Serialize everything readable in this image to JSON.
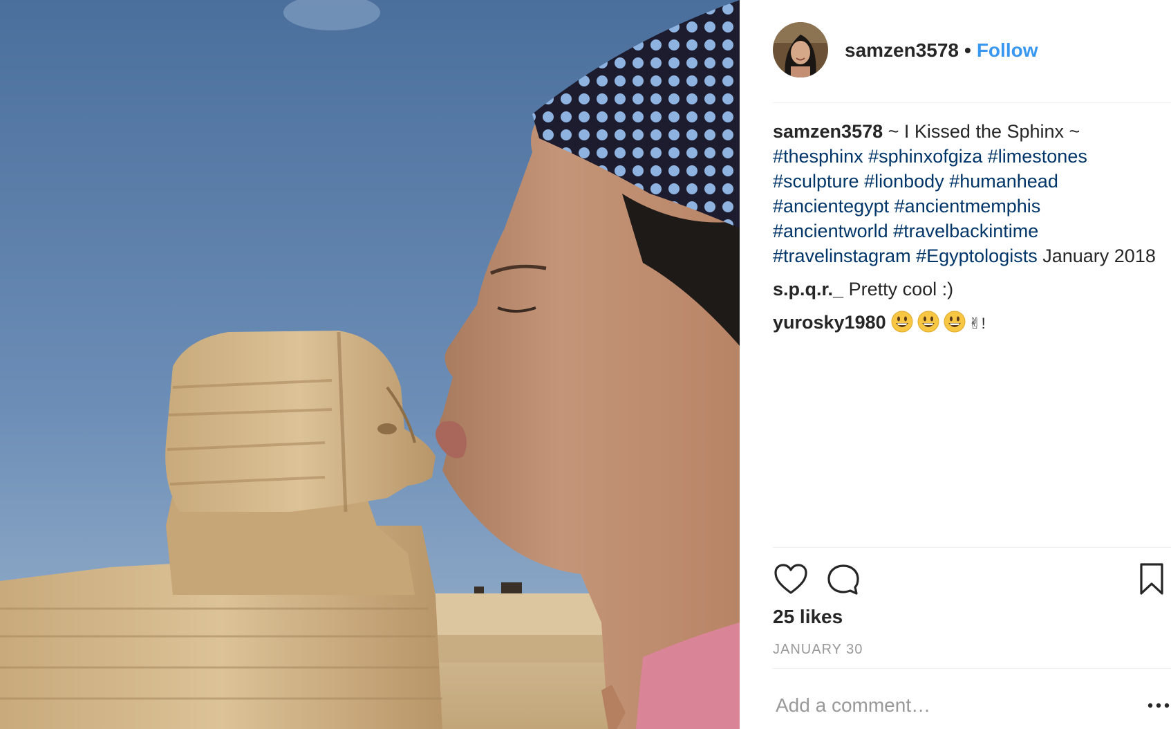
{
  "header": {
    "username": "samzen3578",
    "separator": "•",
    "follow_label": "Follow"
  },
  "caption": {
    "author": "samzen3578",
    "text": "~ I Kissed the Sphinx ~",
    "hashtags": [
      "#thesphinx",
      "#sphinxofgiza",
      "#limestones",
      "#sculpture",
      "#lionbody",
      "#humanhead",
      "#ancientegypt",
      "#ancientmemphis",
      "#ancientworld",
      "#travelbackintime",
      "#travelinstagram",
      "#Egyptologists"
    ],
    "suffix": "January 2018"
  },
  "comments": [
    {
      "author": "s.p.q.r._",
      "text": "Pretty cool :)"
    },
    {
      "author": "yurosky1980",
      "emoji_count": 3,
      "emoji_icon": "grinning-face-emoji",
      "tail": "✌!"
    }
  ],
  "actions": {
    "icons": [
      "heart-icon",
      "comment-icon",
      "bookmark-icon"
    ]
  },
  "likes": "25 likes",
  "date": "JANUARY 30",
  "add_comment": {
    "placeholder": "Add a comment…",
    "more_label": "•••"
  },
  "colors": {
    "link_blue": "#3897f0",
    "hashtag": "#003569",
    "text": "#262626",
    "muted": "#999999",
    "divider": "#efefef"
  }
}
